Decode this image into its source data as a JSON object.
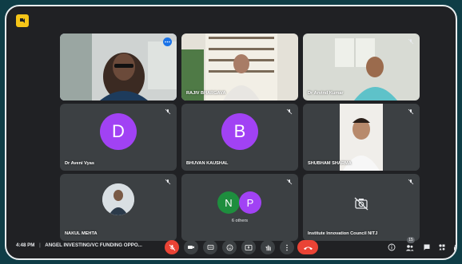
{
  "meeting": {
    "time": "4:48 PM",
    "separator": "|",
    "title": "ANGEL INVESTING/VC FUNDING OPPO..."
  },
  "participants": [
    {
      "name": "",
      "kind": "video",
      "active": true
    },
    {
      "name": "RAJIV BHARGAVA",
      "kind": "video"
    },
    {
      "name": "Dr Arvind Kumar",
      "kind": "video"
    },
    {
      "name": "Dr Aveni Vyas",
      "kind": "avatar",
      "initial": "D",
      "color": "#a142f4"
    },
    {
      "name": "BHUVAN KAUSHAL",
      "kind": "avatar",
      "initial": "B",
      "color": "#a142f4"
    },
    {
      "name": "SHUBHAM SHARMA",
      "kind": "video"
    },
    {
      "name": "NAKUL MEHTA",
      "kind": "photo"
    },
    {
      "name": "6 others",
      "kind": "others",
      "initials": [
        "N",
        "P"
      ],
      "colors": [
        "#1e8e3e",
        "#a142f4"
      ]
    },
    {
      "name": "Institute Innovation Council NITJ",
      "kind": "camera-off"
    }
  ],
  "controls": {
    "participants_count": "15"
  },
  "icons": {
    "mic_muted": "mic-off-icon",
    "camera": "camera-icon",
    "captions": "captions-icon",
    "emoji": "emoji-icon",
    "present": "present-icon",
    "hand": "raise-hand-icon",
    "more": "more-options-icon",
    "end": "end-call-icon",
    "info": "info-icon",
    "people": "people-icon",
    "chat": "chat-icon",
    "activities": "activities-icon",
    "lock": "host-controls-icon"
  },
  "colors": {
    "background": "#202124",
    "tile": "#3c4043",
    "danger": "#ea4335",
    "active_outline": "#8ab4f8"
  }
}
